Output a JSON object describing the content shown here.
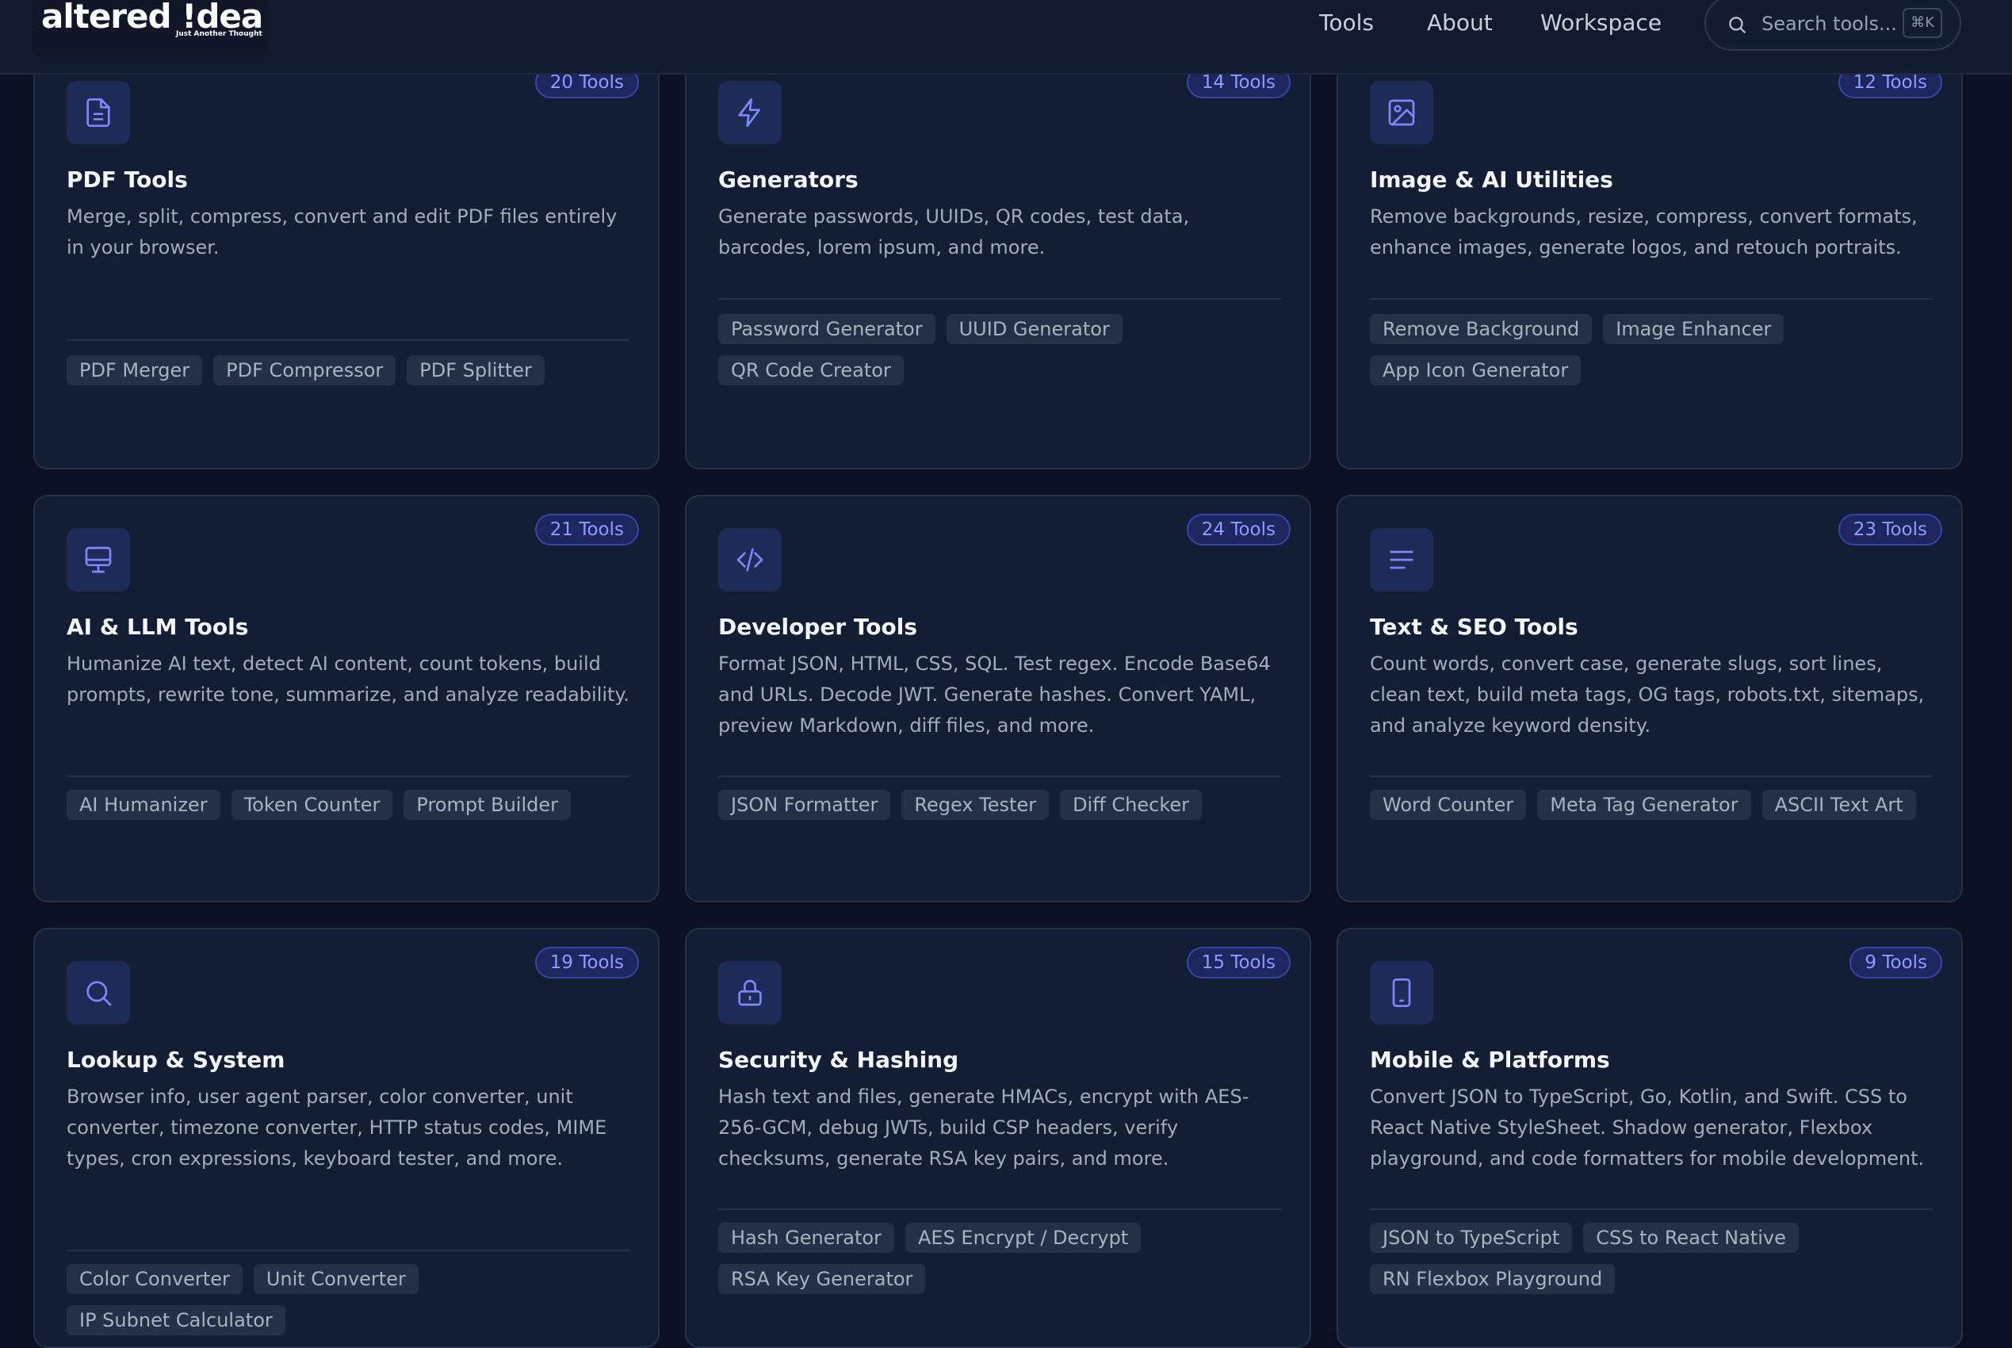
{
  "nav": {
    "logo_text": "altered !dea",
    "logo_tagline": "Just Another Thought",
    "links": [
      "Tools",
      "About",
      "Workspace"
    ],
    "search_placeholder": "Search tools...",
    "search_shortcut": "⌘K"
  },
  "cards": [
    {
      "icon": "file-text-icon",
      "badge": "20 Tools",
      "title": "PDF Tools",
      "description": "Merge, split, compress, convert and edit PDF files entirely in your browser.",
      "tags": [
        "PDF Merger",
        "PDF Compressor",
        "PDF Splitter"
      ]
    },
    {
      "icon": "lightning-icon",
      "badge": "14 Tools",
      "title": "Generators",
      "description": "Generate passwords, UUIDs, QR codes, test data, barcodes, lorem ipsum, and more.",
      "tags": [
        "Password Generator",
        "UUID Generator",
        "QR Code Creator"
      ]
    },
    {
      "icon": "image-icon",
      "badge": "12 Tools",
      "title": "Image & AI Utilities",
      "description": "Remove backgrounds, resize, compress, convert formats, enhance images, generate logos, and retouch portraits.",
      "tags": [
        "Remove Background",
        "Image Enhancer",
        "App Icon Generator"
      ]
    },
    {
      "icon": "monitor-icon",
      "badge": "21 Tools",
      "title": "AI & LLM Tools",
      "description": "Humanize AI text, detect AI content, count tokens, build prompts, rewrite tone, summarize, and analyze readability.",
      "tags": [
        "AI Humanizer",
        "Token Counter",
        "Prompt Builder"
      ]
    },
    {
      "icon": "code-icon",
      "badge": "24 Tools",
      "title": "Developer Tools",
      "description": "Format JSON, HTML, CSS, SQL. Test regex. Encode Base64 and URLs. Decode JWT. Generate hashes. Convert YAML, preview Markdown, diff files, and more.",
      "tags": [
        "JSON Formatter",
        "Regex Tester",
        "Diff Checker"
      ]
    },
    {
      "icon": "text-lines-icon",
      "badge": "23 Tools",
      "title": "Text & SEO Tools",
      "description": "Count words, convert case, generate slugs, sort lines, clean text, build meta tags, OG tags, robots.txt, sitemaps, and analyze keyword density.",
      "tags": [
        "Word Counter",
        "Meta Tag Generator",
        "ASCII Text Art"
      ]
    },
    {
      "icon": "search-icon",
      "badge": "19 Tools",
      "title": "Lookup & System",
      "description": "Browser info, user agent parser, color converter, unit converter, timezone converter, HTTP status codes, MIME types, cron expressions, keyboard tester, and more.",
      "tags": [
        "Color Converter",
        "Unit Converter",
        "IP Subnet Calculator"
      ]
    },
    {
      "icon": "lock-icon",
      "badge": "15 Tools",
      "title": "Security & Hashing",
      "description": "Hash text and files, generate HMACs, encrypt with AES-256-GCM, debug JWTs, build CSP headers, verify checksums, generate RSA key pairs, and more.",
      "tags": [
        "Hash Generator",
        "AES Encrypt / Decrypt",
        "RSA Key Generator"
      ]
    },
    {
      "icon": "smartphone-icon",
      "badge": "9 Tools",
      "title": "Mobile & Platforms",
      "description": "Convert JSON to TypeScript, Go, Kotlin, and Swift. CSS to React Native StyleSheet. Shadow generator, Flexbox playground, and code formatters for mobile development.",
      "tags": [
        "JSON to TypeScript",
        "CSS to React Native",
        "RN Flexbox Playground"
      ]
    }
  ]
}
